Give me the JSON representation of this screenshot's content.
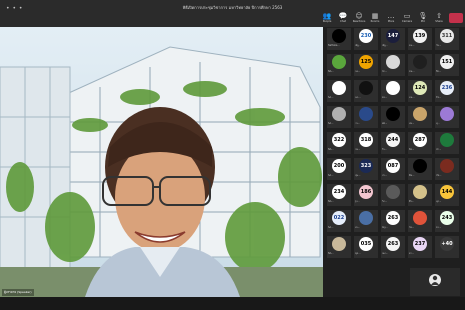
{
  "window": {
    "title": "พิธีเปิดการประชุมวิชาการ มหาวิทยาลัย ปีการศึกษา 2563",
    "window_dots": "• • •"
  },
  "toolbar": {
    "items": [
      {
        "icon": "people-icon",
        "glyph": "👥",
        "label": "People"
      },
      {
        "icon": "chat-icon",
        "glyph": "💬",
        "label": "Chat"
      },
      {
        "icon": "reactions-icon",
        "glyph": "☺",
        "label": "Reactions"
      },
      {
        "icon": "rooms-icon",
        "glyph": "▦",
        "label": "Rooms"
      },
      {
        "icon": "more-icon",
        "glyph": "…",
        "label": "More"
      },
      {
        "icon": "camera-icon",
        "glyph": "▭",
        "label": "Camera"
      },
      {
        "icon": "mic-icon",
        "glyph": "🎙",
        "label": "Mic"
      },
      {
        "icon": "share-icon",
        "glyph": "⇧",
        "label": "Share"
      }
    ],
    "leave_color": "#c4314b"
  },
  "main_video": {
    "name_label": "ผู้บรรยาย (Speaker)"
  },
  "participants": [
    {
      "text": "",
      "bg": "#000000",
      "fg": "#ffffff",
      "name": "Nattaka..."
    },
    {
      "text": "230",
      "bg": "#ffffff",
      "fg": "#1a5fb4",
      "name": "ณัฐ..."
    },
    {
      "text": "147",
      "bg": "#1b1e3c",
      "fg": "#ffffff",
      "name": "ณัฐ..."
    },
    {
      "text": "139",
      "bg": "#f2f2f2",
      "fg": "#000000",
      "name": "ธน..."
    },
    {
      "text": "311",
      "bg": "#e8e8e8",
      "fg": "#333333",
      "name": "วัน..."
    },
    {
      "text": "",
      "bg": "#5aa63c",
      "fg": "#ffffff",
      "name": "NA..."
    },
    {
      "text": "125",
      "bg": "#f0a400",
      "fg": "#000000",
      "name": "กล..."
    },
    {
      "text": "",
      "bg": "#d8d8d8",
      "fg": "#444444",
      "name": "จัก..."
    },
    {
      "text": "",
      "bg": "#1f1f1f",
      "fg": "#ffffff",
      "name": "ชน..."
    },
    {
      "text": "151",
      "bg": "#f0f0f0",
      "fg": "#000000",
      "name": "ปิย..."
    },
    {
      "text": "",
      "bg": "#ffffff",
      "fg": "#333333",
      "name": "SA..."
    },
    {
      "text": "",
      "bg": "#111111",
      "fg": "#ffffff",
      "name": "นภ..."
    },
    {
      "text": "",
      "bg": "#ffffff",
      "fg": "#333333",
      "name": "พร..."
    },
    {
      "text": "124",
      "bg": "#dfe9b8",
      "fg": "#000000",
      "name": "มน..."
    },
    {
      "text": "236",
      "bg": "#e8eef8",
      "fg": "#1a3f8f",
      "name": "รัช..."
    },
    {
      "text": "",
      "bg": "#b0b0b0",
      "fg": "#000000",
      "name": "SA..."
    },
    {
      "text": "",
      "bg": "#2a4a8a",
      "fg": "#ffffff",
      "name": "วร..."
    },
    {
      "text": "",
      "bg": "#000000",
      "fg": "#ffffff",
      "name": "ศศ..."
    },
    {
      "text": "",
      "bg": "#c9a46a",
      "fg": "#000000",
      "name": "สม..."
    },
    {
      "text": "",
      "bg": "#9c7ad6",
      "fg": "#ffffff",
      "name": "สุ..."
    },
    {
      "text": "322",
      "bg": "#ffffff",
      "fg": "#000000",
      "name": "NA..."
    },
    {
      "text": "318",
      "bg": "#ffffff",
      "fg": "#000000",
      "name": "กม..."
    },
    {
      "text": "244",
      "bg": "#f5f5f5",
      "fg": "#000000",
      "name": "จิร..."
    },
    {
      "text": "287",
      "bg": "#ffffff",
      "fg": "#000000",
      "name": "ธิด..."
    },
    {
      "text": "",
      "bg": "#1e7a3c",
      "fg": "#ffffff",
      "name": "น้ำ..."
    },
    {
      "text": "200",
      "bg": "#ffffff",
      "fg": "#000000",
      "name": "SA..."
    },
    {
      "text": "323",
      "bg": "#1b2a55",
      "fg": "#ffffff",
      "name": "บุษ..."
    },
    {
      "text": "087",
      "bg": "#ffffff",
      "fg": "#000000",
      "name": "ปว..."
    },
    {
      "text": "",
      "bg": "#000000",
      "fg": "#ffffff",
      "name": "พิม..."
    },
    {
      "text": "",
      "bg": "#7b2b1f",
      "fg": "#ffffff",
      "name": "ภัท..."
    },
    {
      "text": "234",
      "bg": "#ffffff",
      "fg": "#000000",
      "name": "NA..."
    },
    {
      "text": "186",
      "bg": "#f3c6d0",
      "fg": "#000000",
      "name": "รุ่ง..."
    },
    {
      "text": "",
      "bg": "#5a5a5a",
      "fg": "#ffffff",
      "name": "วิภ..."
    },
    {
      "text": "",
      "bg": "#d4c18a",
      "fg": "#000000",
      "name": "ศิร..."
    },
    {
      "text": "144",
      "bg": "#f8c43a",
      "fg": "#000000",
      "name": "สุภ..."
    },
    {
      "text": "022",
      "bg": "#e6eefb",
      "fg": "#1a3f8f",
      "name": "SA..."
    },
    {
      "text": "",
      "bg": "#4a6fa5",
      "fg": "#ffffff",
      "name": "อร..."
    },
    {
      "text": "263",
      "bg": "#ffffff",
      "fg": "#000000",
      "name": "อัญ..."
    },
    {
      "text": "",
      "bg": "#e0533a",
      "fg": "#ffffff",
      "name": "กัล..."
    },
    {
      "text": "243",
      "bg": "#eaffea",
      "fg": "#000000",
      "name": "ขว..."
    },
    {
      "text": "",
      "bg": "#c8b89a",
      "fg": "#000000",
      "name": "NA..."
    },
    {
      "text": "035",
      "bg": "#ffffff",
      "fg": "#000000",
      "name": "ชุต..."
    },
    {
      "text": "263",
      "bg": "#f5f5f5",
      "fg": "#000000",
      "name": "ณภ..."
    },
    {
      "text": "237",
      "bg": "#e9d6f5",
      "fg": "#000000",
      "name": "ดา..."
    },
    {
      "text": "+40",
      "bg": "#3a3a3a",
      "fg": "#ffffff",
      "name": ""
    }
  ],
  "self_view": {
    "label": ""
  }
}
